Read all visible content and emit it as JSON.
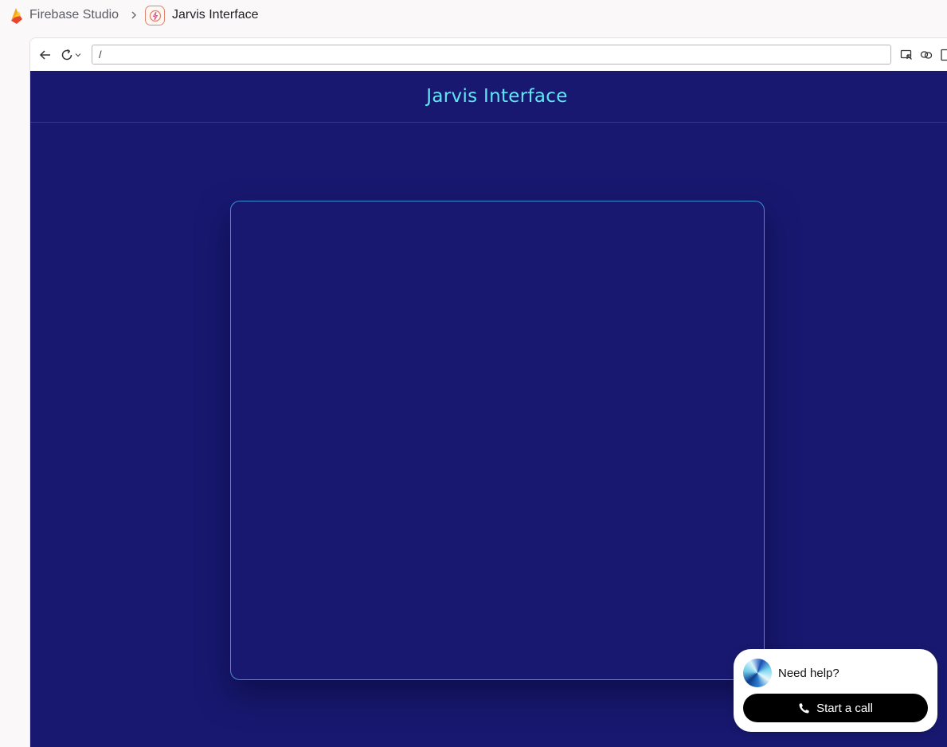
{
  "studio": {
    "app_name": "Firebase Studio",
    "project_name": "Jarvis Interface"
  },
  "browser": {
    "url": "/"
  },
  "app": {
    "title": "Jarvis Interface",
    "colors": {
      "background": "#181870",
      "title": "#62e4f5",
      "panel_border": "#3f8fd6"
    }
  },
  "help_widget": {
    "prompt": "Need help?",
    "call_label": "Start a call"
  }
}
